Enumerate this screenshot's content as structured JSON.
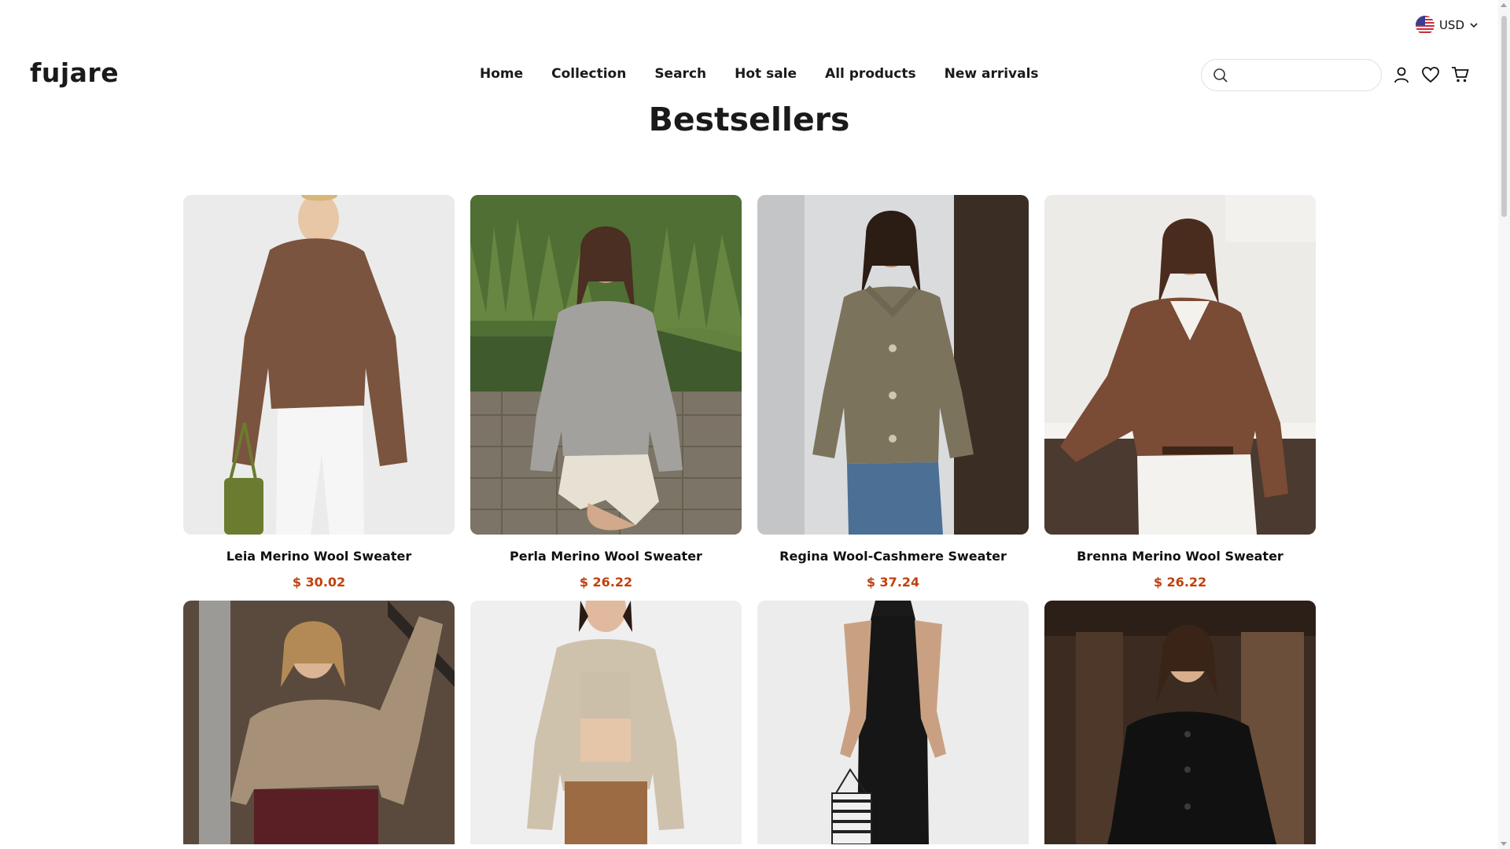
{
  "currency": {
    "code": "USD",
    "flag_icon": "us-flag-icon"
  },
  "header": {
    "logo": "fujare",
    "nav": [
      "Home",
      "Collection",
      "Search",
      "Hot sale",
      "All products",
      "New arrivals"
    ],
    "search_placeholder": "",
    "icons": [
      "search-icon",
      "account-icon",
      "wishlist-heart-icon",
      "cart-icon"
    ]
  },
  "main": {
    "title": "Bestsellers",
    "products": [
      {
        "name": "Leia Merino Wool Sweater",
        "price": "$ 30.02"
      },
      {
        "name": "Perla Merino Wool Sweater",
        "price": "$ 26.22"
      },
      {
        "name": "Regina Wool-Cashmere Sweater",
        "price": "$ 37.24"
      },
      {
        "name": "Brenna Merino Wool Sweater",
        "price": "$ 26.22"
      }
    ]
  },
  "colors": {
    "price": "#c2410c",
    "text": "#1a1a1a"
  }
}
